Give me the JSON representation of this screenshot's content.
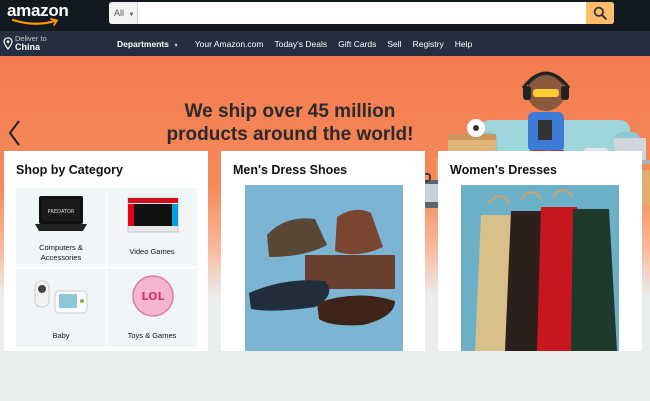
{
  "header": {
    "logo_text": "amazon",
    "search": {
      "category": "All",
      "placeholder": ""
    }
  },
  "nav": {
    "deliver_label": "Deliver to",
    "deliver_location": "China",
    "departments": "Departments",
    "links": [
      "Your Amazon.com",
      "Today's Deals",
      "Gift Cards",
      "Sell",
      "Registry",
      "Help"
    ]
  },
  "hero": {
    "line1": "We ship over 45 million",
    "line2": "products around the world!"
  },
  "cards": {
    "category": {
      "title": "Shop by Category",
      "items": [
        {
          "label_line1": "Computers &",
          "label_line2": "Accessories"
        },
        {
          "label_line1": "Video Games",
          "label_line2": ""
        },
        {
          "label_line1": "Baby",
          "label_line2": ""
        },
        {
          "label_line1": "Toys & Games",
          "label_line2": ""
        }
      ]
    },
    "shoes": {
      "title": "Men's Dress Shoes"
    },
    "dresses": {
      "title": "Women's Dresses"
    }
  },
  "colors": {
    "header_bg": "#131921",
    "nav_bg": "#232f3e",
    "search_button": "#febd69",
    "hero_bg": "#f47b50"
  },
  "icons": [
    "location-pin-icon",
    "search-icon",
    "caret-down-icon",
    "chevron-left-icon"
  ]
}
